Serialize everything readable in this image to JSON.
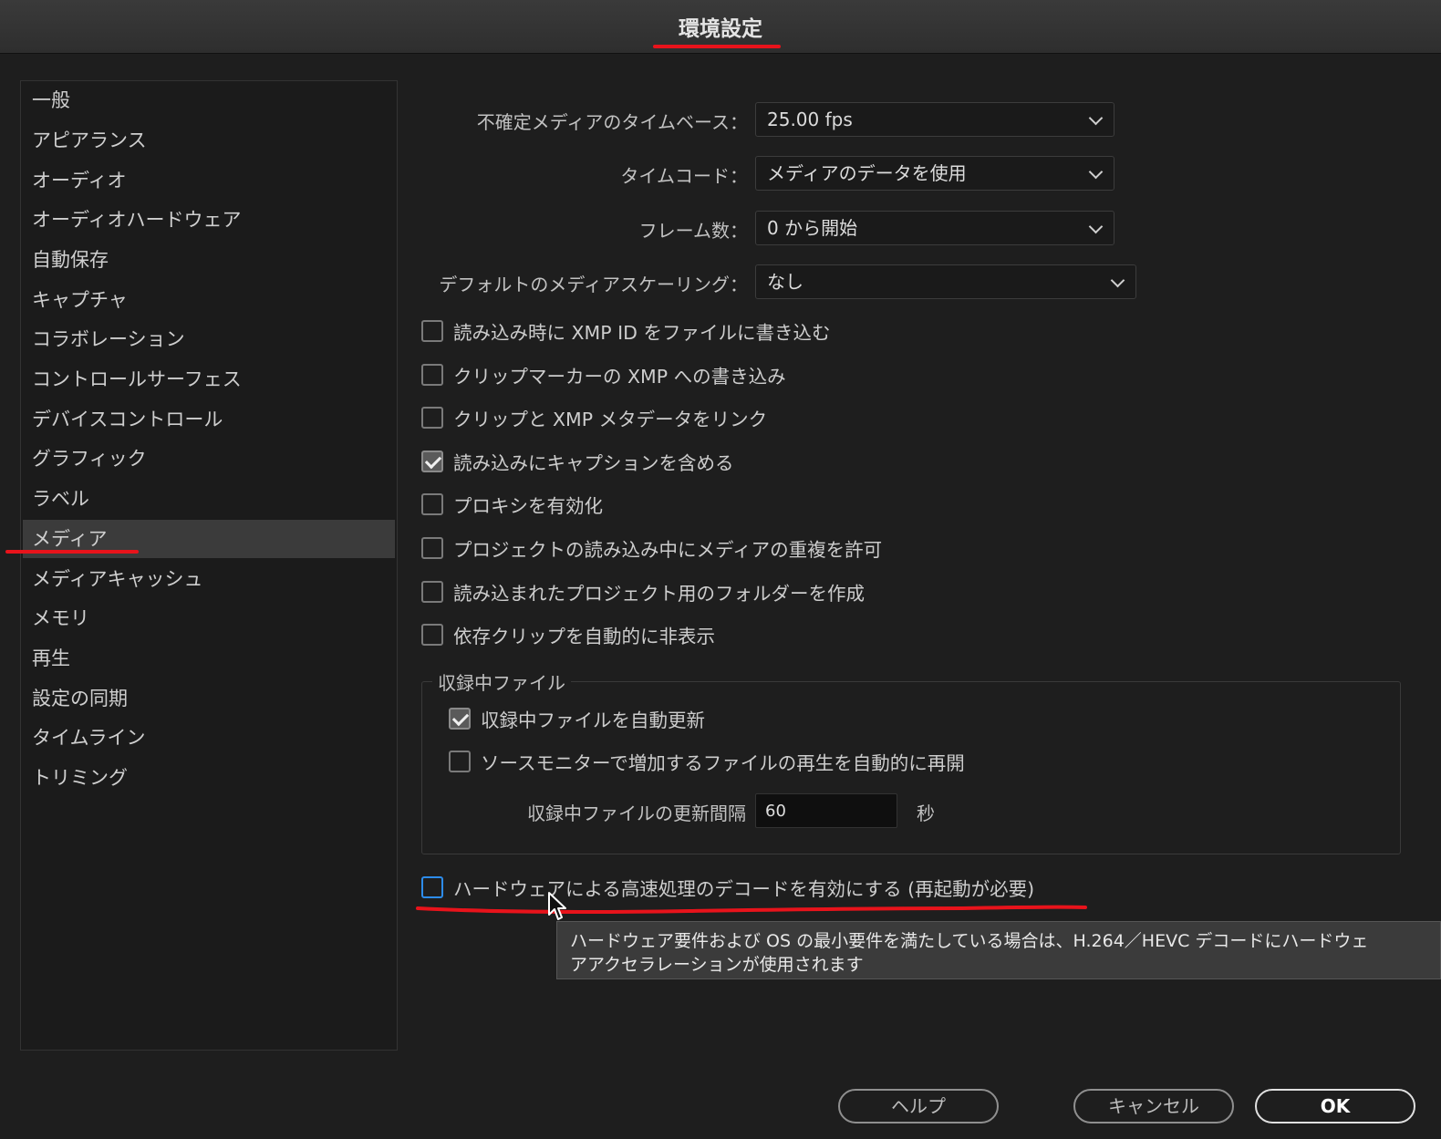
{
  "window": {
    "title": "環境設定"
  },
  "sidebar": {
    "items": [
      {
        "label": "一般"
      },
      {
        "label": "アピアランス"
      },
      {
        "label": "オーディオ"
      },
      {
        "label": "オーディオハードウェア"
      },
      {
        "label": "自動保存"
      },
      {
        "label": "キャプチャ"
      },
      {
        "label": "コラボレーション"
      },
      {
        "label": "コントロールサーフェス"
      },
      {
        "label": "デバイスコントロール"
      },
      {
        "label": "グラフィック"
      },
      {
        "label": "ラベル"
      },
      {
        "label": "メディア",
        "selected": true
      },
      {
        "label": "メディアキャッシュ"
      },
      {
        "label": "メモリ"
      },
      {
        "label": "再生"
      },
      {
        "label": "設定の同期"
      },
      {
        "label": "タイムライン"
      },
      {
        "label": "トリミング"
      }
    ]
  },
  "settings": {
    "timebase": {
      "label": "不確定メディアのタイムベース：",
      "value": "25.00 fps"
    },
    "timecode": {
      "label": "タイムコード：",
      "value": "メディアのデータを使用"
    },
    "frame_count": {
      "label": "フレーム数：",
      "value": "0 から開始"
    },
    "scaling": {
      "label": "デフォルトのメディアスケーリング：",
      "value": "なし"
    },
    "checkboxes": [
      {
        "label": "読み込み時に XMP ID をファイルに書き込む",
        "checked": false
      },
      {
        "label": "クリップマーカーの XMP への書き込み",
        "checked": false
      },
      {
        "label": "クリップと XMP メタデータをリンク",
        "checked": false
      },
      {
        "label": "読み込みにキャプションを含める",
        "checked": true
      },
      {
        "label": "プロキシを有効化",
        "checked": false
      },
      {
        "label": "プロジェクトの読み込み中にメディアの重複を許可",
        "checked": false
      },
      {
        "label": "読み込まれたプロジェクト用のフォルダーを作成",
        "checked": false
      },
      {
        "label": "依存クリップを自動的に非表示",
        "checked": false
      }
    ],
    "growing_files": {
      "title": "収録中ファイル",
      "auto_refresh": {
        "label": "収録中ファイルを自動更新",
        "checked": true
      },
      "resume_playback": {
        "label": "ソースモニターで増加するファイルの再生を自動的に再開",
        "checked": false
      },
      "refresh_interval": {
        "label": "収録中ファイルの更新間隔",
        "value": "60",
        "unit": "秒"
      }
    },
    "hw_decode": {
      "label": "ハードウェアによる高速処理のデコードを有効にする (再起動が必要)",
      "checked": false
    },
    "tooltip": {
      "line1": "ハードウェア要件および OS の最小要件を満たしている場合は、H.264／HEVC デコードにハードウェ",
      "line2": "アアクセラレーションが使用されます"
    }
  },
  "buttons": {
    "help": "ヘルプ",
    "cancel": "キャンセル",
    "ok": "OK"
  },
  "colors": {
    "annotation": "#e8131b",
    "focus": "#2d8ceb"
  }
}
